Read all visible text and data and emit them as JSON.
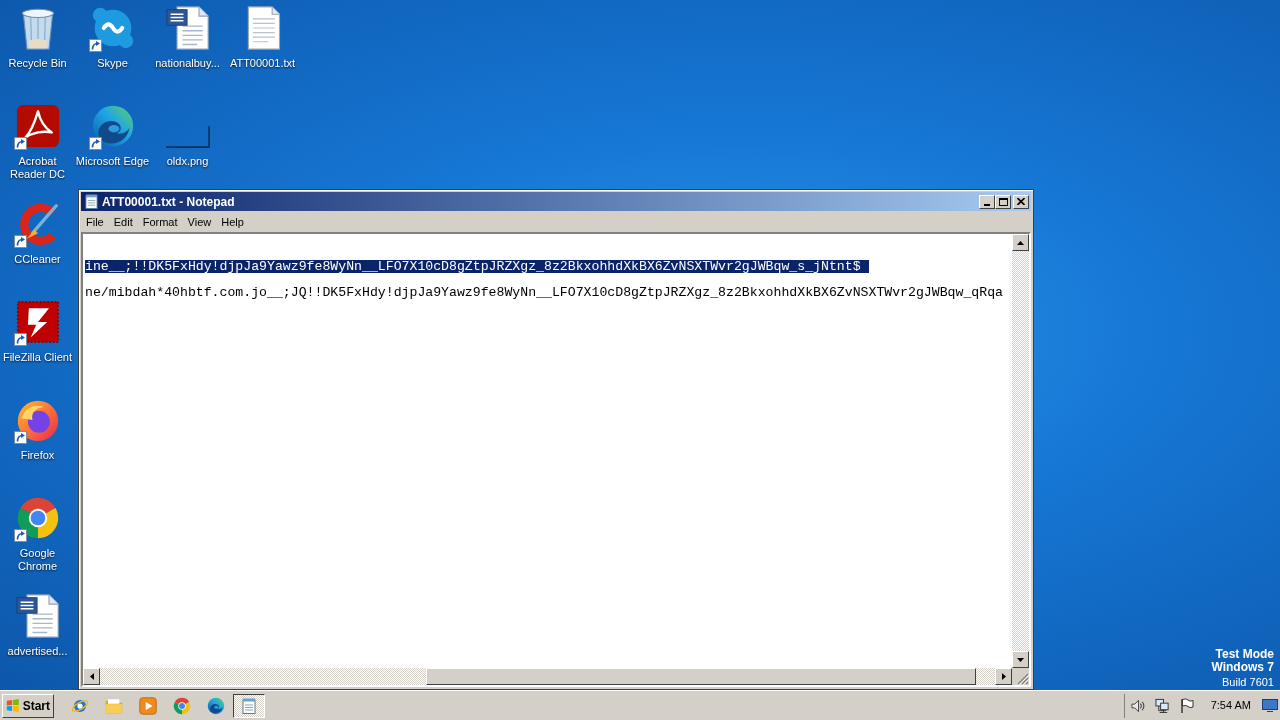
{
  "desktop": {
    "icon_columns": [
      [
        {
          "kind": "recycle_bin",
          "label": "Recycle Bin",
          "shortcut": false
        },
        {
          "kind": "acrobat",
          "label": "Acrobat Reader DC",
          "shortcut": true
        },
        {
          "kind": "ccleaner",
          "label": "CCleaner",
          "shortcut": true
        },
        {
          "kind": "filezilla",
          "label": "FileZilla Client",
          "shortcut": true
        },
        {
          "kind": "firefox",
          "label": "Firefox",
          "shortcut": true
        },
        {
          "kind": "chrome",
          "label": "Google Chrome",
          "shortcut": true
        },
        {
          "kind": "word_document",
          "label": "advertised...",
          "shortcut": false
        }
      ],
      [
        {
          "kind": "skype",
          "label": "Skype",
          "shortcut": true
        },
        {
          "kind": "edge",
          "label": "Microsoft Edge",
          "shortcut": true
        }
      ],
      [
        {
          "kind": "word_document",
          "label": "nationalbuy...",
          "shortcut": false
        },
        {
          "kind": "image_file",
          "label": "oldx.png",
          "shortcut": false
        }
      ],
      [
        {
          "kind": "text_file",
          "label": "ATT00001.txt",
          "shortcut": false
        }
      ]
    ],
    "system_notice": [
      {
        "text": "Test Mode",
        "bold": true
      },
      {
        "text": "Windows 7",
        "bold": true
      },
      {
        "text": "Build 7601",
        "bold": false
      }
    ]
  },
  "notepad": {
    "title": "ATT00001.txt - Notepad",
    "menu": [
      "File",
      "Edit",
      "Format",
      "View",
      "Help"
    ],
    "lines": [
      {
        "text": "ine__;!!DK5FxHdy!djpJa9Yawz9fe8WyNn__LFO7X10cD8gZtpJRZXgz_8z2BkxohhdXkBX6ZvNSXTWvr2gJWBqw_s_jNtnt$",
        "selected": true
      },
      {
        "text": "ne/mibdah*40hbtf.com.jo__;JQ!!DK5FxHdy!djpJa9Yawz9fe8WyNn__LFO7X10cD8gZtpJRZXgz_8z2BkxohhdXkBX6ZvNSXTWvr2gJWBqw_qRqa",
        "selected": false
      }
    ]
  },
  "taskbar": {
    "start": "Start",
    "task_button": {
      "active": true
    },
    "clock": "7:54 AM"
  }
}
